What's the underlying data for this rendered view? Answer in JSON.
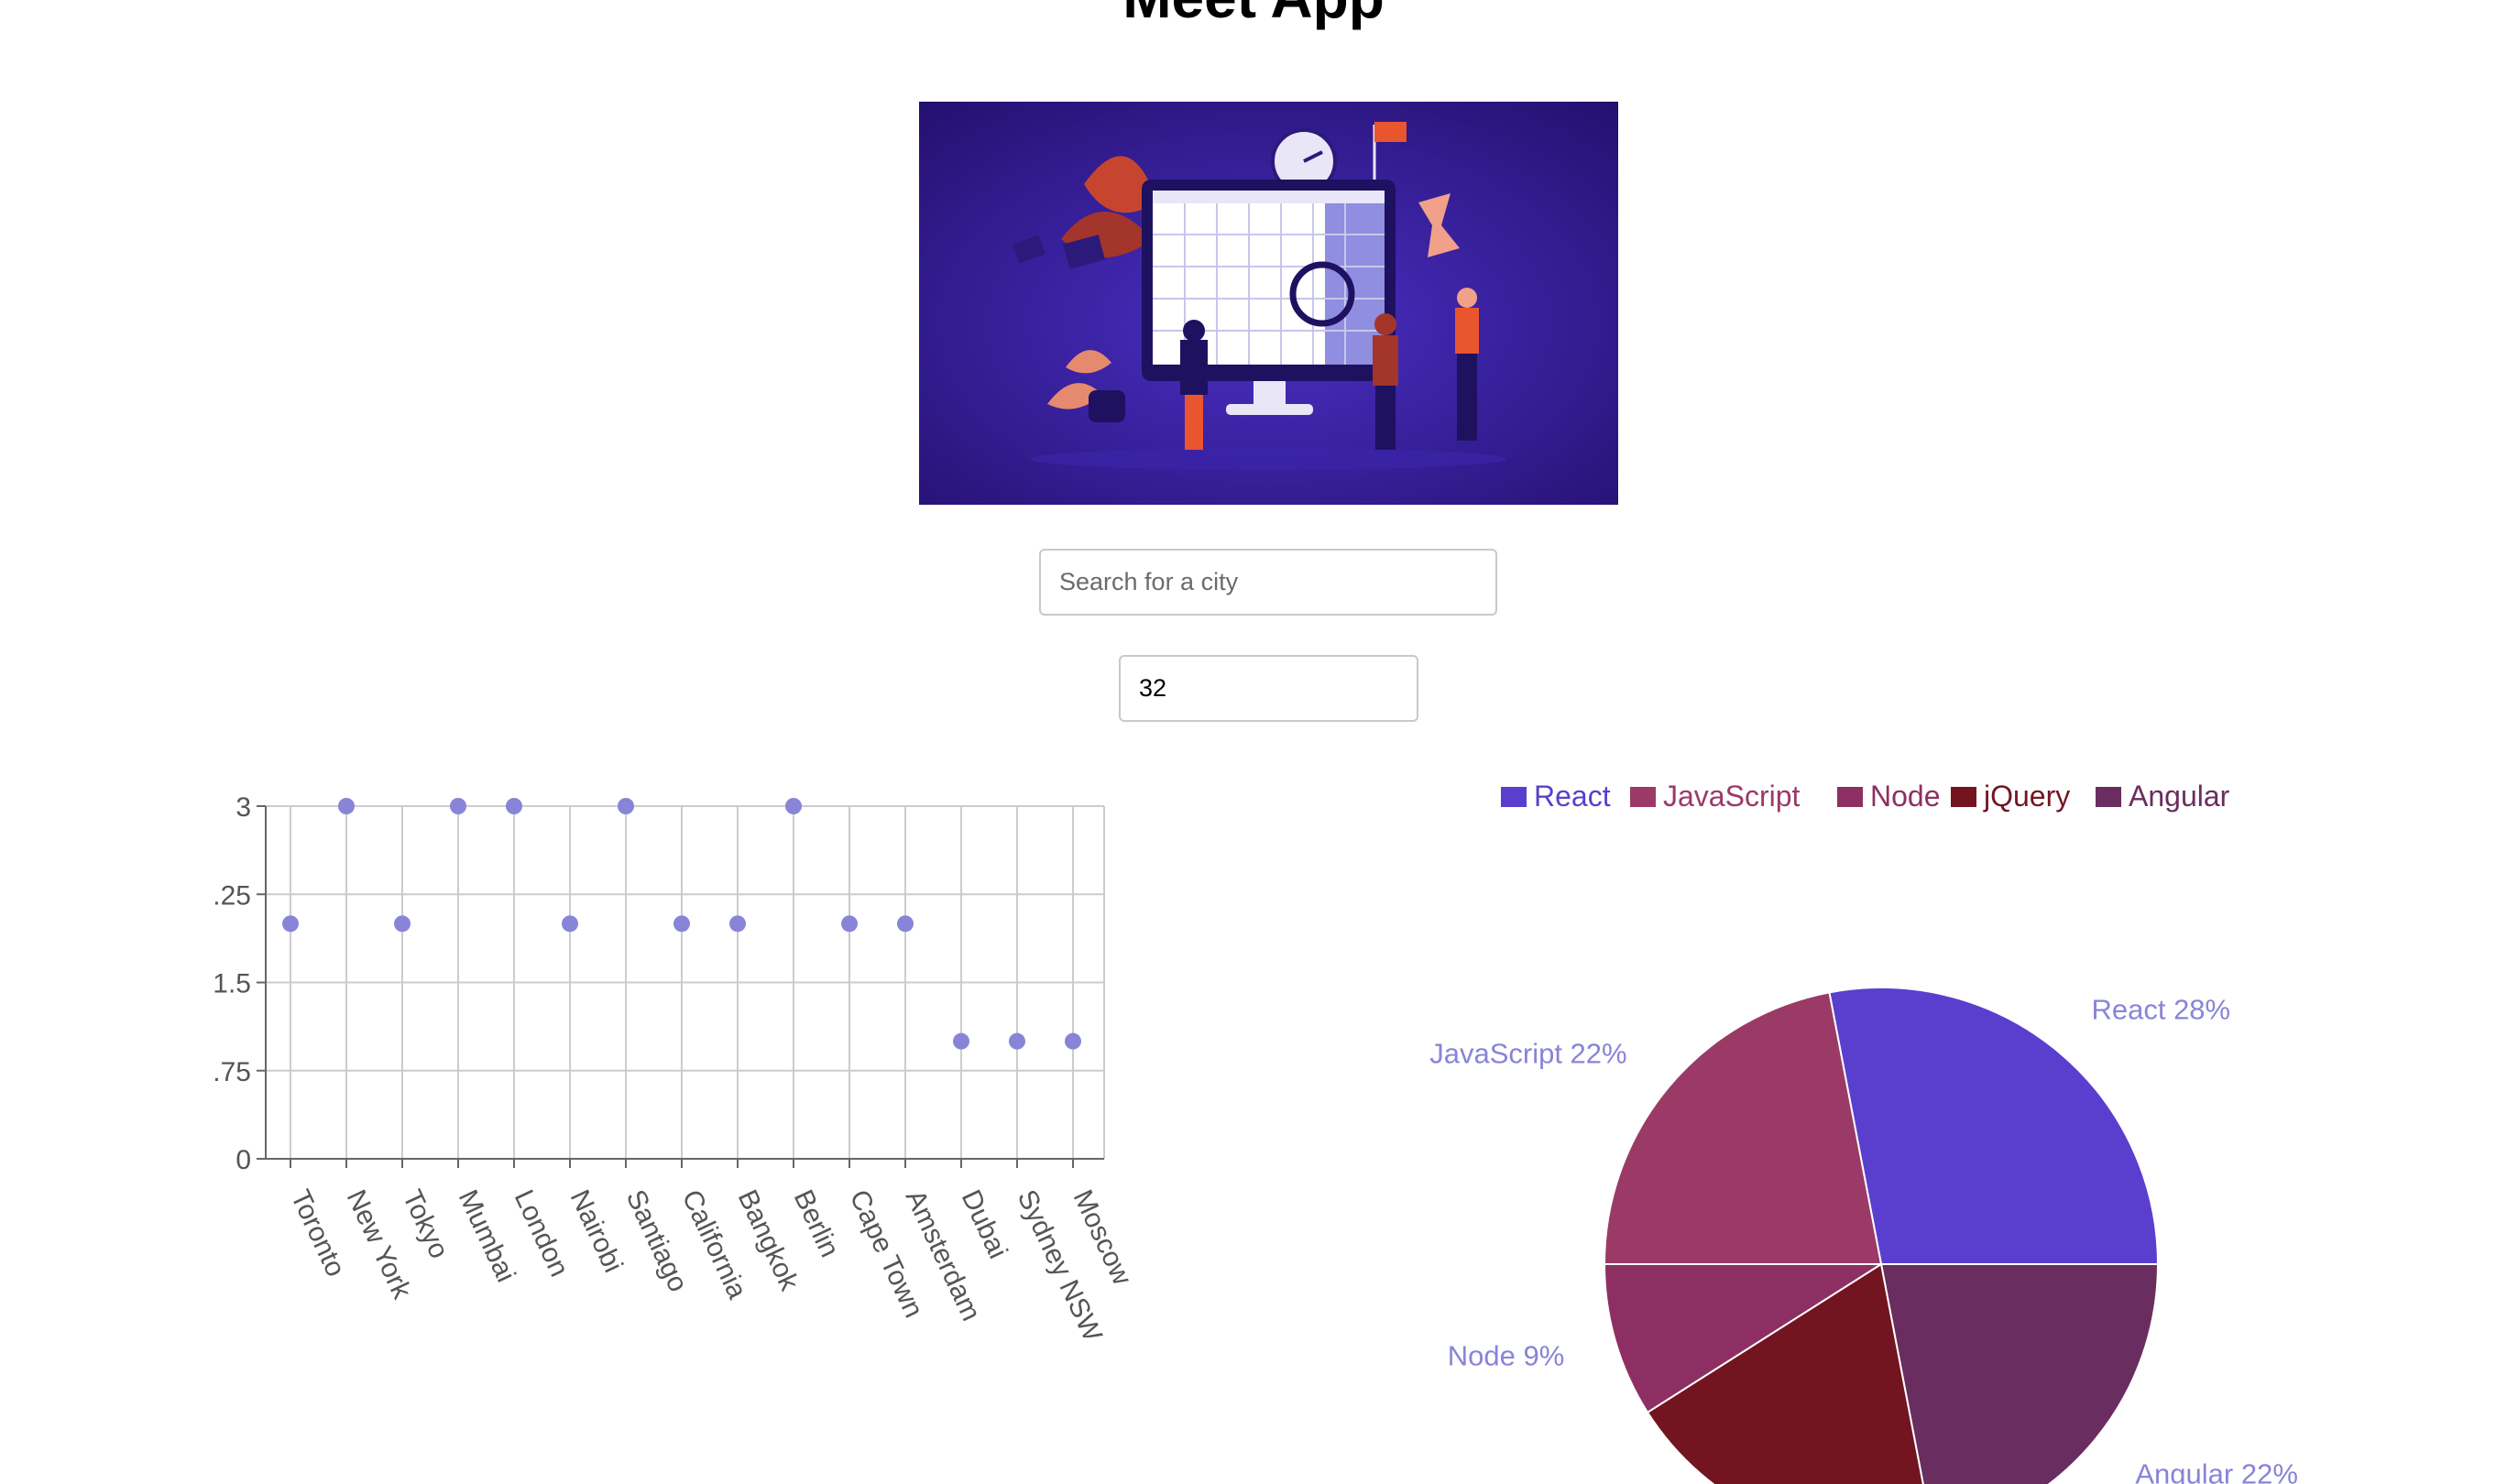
{
  "app": {
    "title": "Meet App"
  },
  "search": {
    "placeholder": "Search for a city",
    "value": ""
  },
  "number_of_events": {
    "value": "32"
  },
  "hero": {
    "description": "calendar-illustration"
  },
  "chart_data": [
    {
      "type": "scatter",
      "categories": [
        "Toronto",
        "New York",
        "Tokyo",
        "Mumbai",
        "London",
        "Nairobi",
        "Santiago",
        "California",
        "Bangkok",
        "Berlin",
        "Cape Town",
        "Amsterdam",
        "Dubai",
        "Sydney NSW",
        "Moscow"
      ],
      "values": [
        2,
        3,
        2,
        3,
        3,
        2,
        3,
        2,
        2,
        3,
        2,
        2,
        1,
        1,
        1
      ],
      "ylim": [
        0,
        3
      ],
      "yticks": [
        "0",
        ".75",
        "1.5",
        ".25",
        "3"
      ],
      "point_color": "#8884d8",
      "grid": true
    },
    {
      "type": "pie",
      "legend_position": "top",
      "slices": [
        {
          "name": "React",
          "value": 28,
          "label": "React 28%",
          "color": "#5a3fce"
        },
        {
          "name": "JavaScript",
          "value": 22,
          "label": "JavaScript 22%",
          "color": "#9b3a66"
        },
        {
          "name": "Node",
          "value": 9,
          "label": "Node 9%",
          "color": "#8e2f63"
        },
        {
          "name": "jQuery",
          "value": 19,
          "label": "",
          "color": "#721521"
        },
        {
          "name": "Angular",
          "value": 22,
          "label": "Angular 22%",
          "color": "#692e5f"
        }
      ],
      "slice_order": [
        "React",
        "Angular",
        "jQuery",
        "Node",
        "JavaScript"
      ],
      "label_color": "#8884d8"
    }
  ]
}
